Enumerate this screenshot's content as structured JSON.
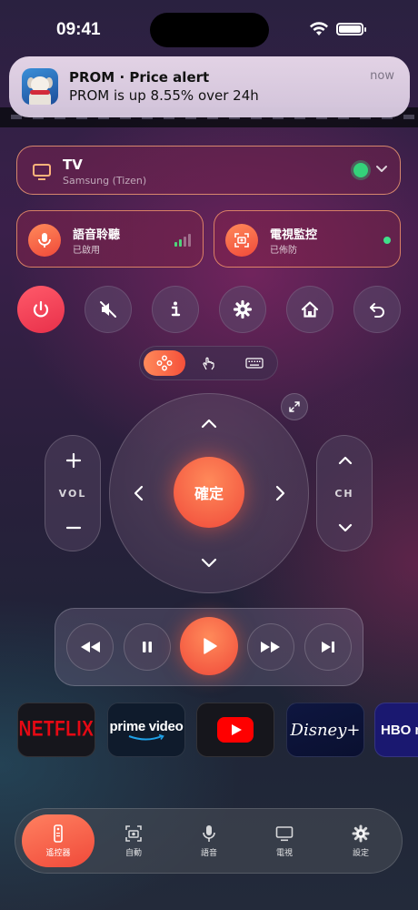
{
  "status_bar": {
    "time": "09:41"
  },
  "notification": {
    "title": "PROM · Price alert",
    "body": "PROM is up 8.55% over 24h",
    "time": "now",
    "app_icon": "dog-app-icon"
  },
  "device": {
    "name": "TV",
    "model": "Samsung (Tizen)",
    "connected": true
  },
  "features": [
    {
      "title": "語音聆聽",
      "status": "已啟用",
      "icon": "microphone-icon"
    },
    {
      "title": "電視監控",
      "status": "已佈防",
      "icon": "camera-scan-icon"
    }
  ],
  "quick_buttons": [
    "power-icon",
    "mute-icon",
    "info-icon",
    "settings-icon",
    "home-icon",
    "back-icon"
  ],
  "mode_switch": {
    "modes": [
      "dpad",
      "touchpad",
      "keyboard"
    ],
    "active": "dpad"
  },
  "dpad": {
    "ok_label": "確定"
  },
  "volume": {
    "label": "VOL"
  },
  "channel": {
    "label": "CH"
  },
  "apps": [
    {
      "name": "NETFLIX"
    },
    {
      "name": "prime video"
    },
    {
      "name": "YouTube"
    },
    {
      "name": "Disney+"
    },
    {
      "name": "HBO max"
    }
  ],
  "tabbar": {
    "items": [
      {
        "label": "遙控器",
        "icon": "remote-icon",
        "active": true
      },
      {
        "label": "自動",
        "icon": "camera-auto-icon",
        "active": false
      },
      {
        "label": "語音",
        "icon": "microphone-icon",
        "active": false
      },
      {
        "label": "電視",
        "icon": "tv-icon",
        "active": false
      },
      {
        "label": "設定",
        "icon": "gear-icon",
        "active": false
      }
    ]
  },
  "colors": {
    "accent": "#f5503a",
    "online": "#34d27a"
  }
}
